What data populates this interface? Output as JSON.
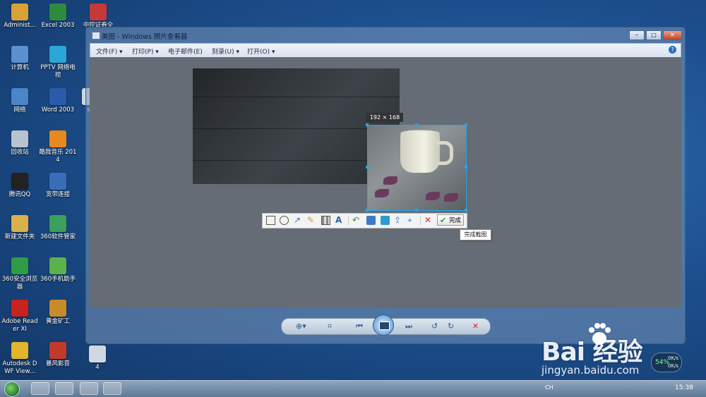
{
  "desktop_icons": [
    {
      "label": "Administ...",
      "color": "#d8a23a"
    },
    {
      "label": "Excel 2003",
      "color": "#2e8b3e"
    },
    {
      "label": "中控证券全",
      "color": "#c43a3a"
    },
    {
      "label": "计算机",
      "color": "#5a8fd0"
    },
    {
      "label": "PPTV 网络电视",
      "color": "#2aa7d8"
    },
    {
      "label": "网络",
      "color": "#4a86c9"
    },
    {
      "label": "Word 2003",
      "color": "#2b5cab"
    },
    {
      "label": "se",
      "color": "#cfd8e3"
    },
    {
      "label": "回收站",
      "color": "#b7c3cf"
    },
    {
      "label": "酷我音乐 2014",
      "color": "#e78a1e"
    },
    {
      "label": "腾讯QQ",
      "color": "#222222"
    },
    {
      "label": "宽带连接",
      "color": "#3a6db8"
    },
    {
      "label": "新建文件夹",
      "color": "#d9b04a"
    },
    {
      "label": "360软件管家",
      "color": "#3aa05a"
    },
    {
      "label": "360安全浏览器",
      "color": "#2f9c46"
    },
    {
      "label": "360手机助手",
      "color": "#5bb24a"
    },
    {
      "label": "Adobe Reader XI",
      "color": "#c8231f"
    },
    {
      "label": "黄金矿工",
      "color": "#c98a2a"
    },
    {
      "label": "Autodesk DWF View...",
      "color": "#e2b52e"
    },
    {
      "label": "暴风影音",
      "color": "#c23a2a"
    },
    {
      "label": "4",
      "color": "#cfd8e3"
    }
  ],
  "window": {
    "title": "美图 - Windows 照片查看器",
    "buttons": {
      "minimize": "‒",
      "maximize": "□",
      "close": "✕"
    },
    "menu": [
      "文件(F) ▾",
      "打印(P) ▾",
      "电子邮件(E)",
      "刻录(U) ▾",
      "打开(O) ▾"
    ],
    "help": "?"
  },
  "capture": {
    "size_label": "192 × 168",
    "tools": [
      "rectangle",
      "ellipse",
      "arrow",
      "pen",
      "mosaic",
      "text",
      "undo",
      "save",
      "copy",
      "share",
      "pin",
      "cancel"
    ],
    "done_label": "完成",
    "tooltip": "完成截图"
  },
  "viewer_controls": {
    "zoom": "⊕▾",
    "fit": "⌗",
    "prev": "⏮",
    "next": "⏭",
    "rotate_ccw": "↺",
    "rotate_cw": "↻",
    "delete": "✕"
  },
  "taskbar": {
    "tray_text": "CH",
    "clock": "15:38"
  },
  "watermark": {
    "brand": "Bai  经验",
    "url": "jingyan.baidu.com"
  },
  "net_meter": {
    "up": "0K/s",
    "down": "0K/s",
    "percent": "54%"
  }
}
